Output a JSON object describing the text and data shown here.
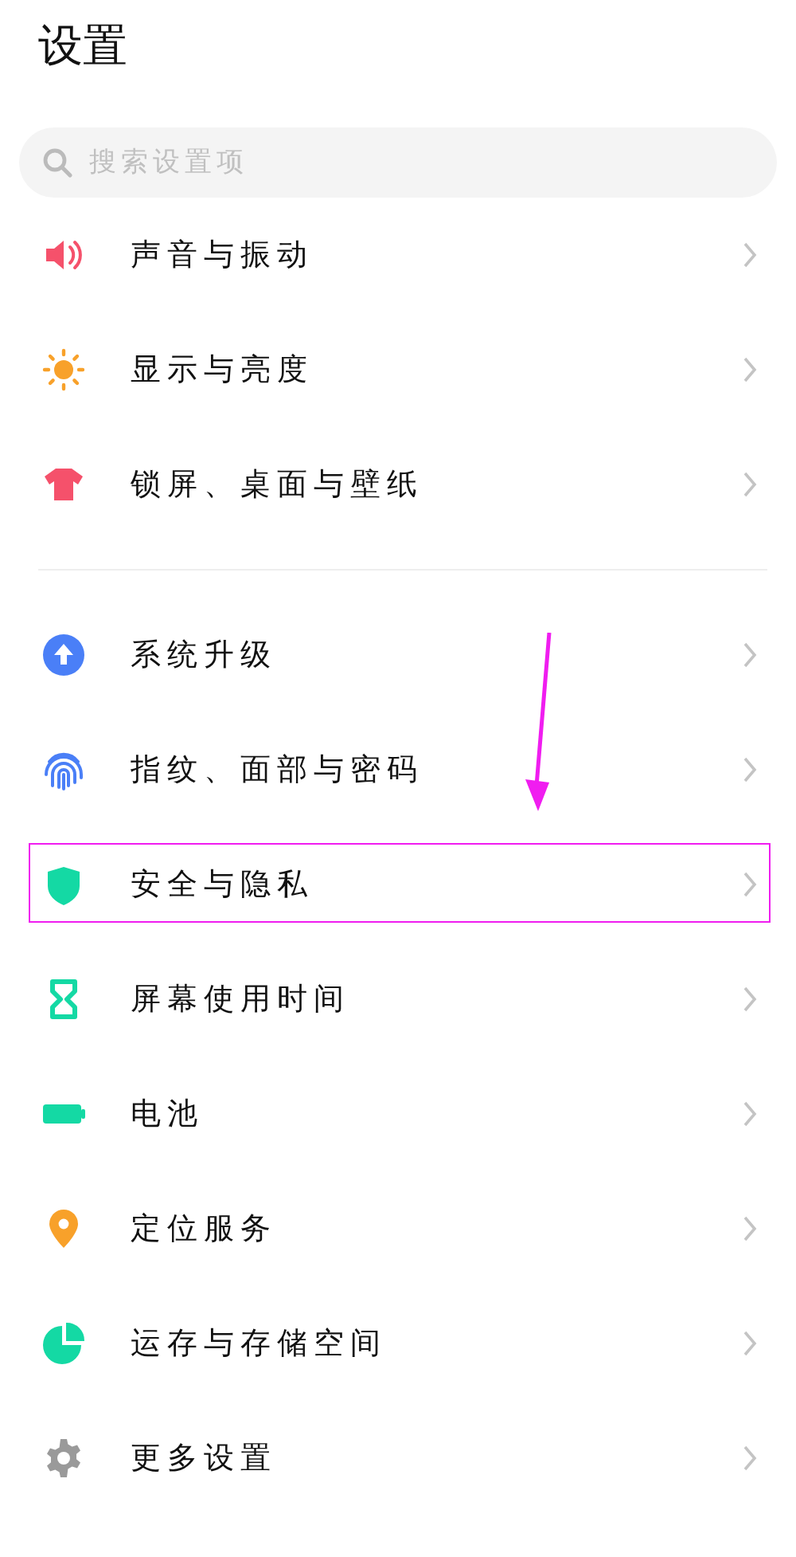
{
  "title": "设置",
  "search": {
    "placeholder": "搜索设置项"
  },
  "groups": [
    {
      "items": [
        {
          "label": "声音与振动",
          "highlighted": false
        },
        {
          "label": "显示与亮度",
          "highlighted": false
        },
        {
          "label": "锁屏、桌面与壁纸",
          "highlighted": false
        }
      ]
    },
    {
      "items": [
        {
          "label": "系统升级",
          "highlighted": false
        },
        {
          "label": "指纹、面部与密码",
          "highlighted": false
        },
        {
          "label": "安全与隐私",
          "highlighted": true
        },
        {
          "label": "屏幕使用时间",
          "highlighted": false
        },
        {
          "label": "电池",
          "highlighted": false
        },
        {
          "label": "定位服务",
          "highlighted": false
        },
        {
          "label": "运存与存储空间",
          "highlighted": false
        },
        {
          "label": "更多设置",
          "highlighted": false
        }
      ]
    }
  ]
}
